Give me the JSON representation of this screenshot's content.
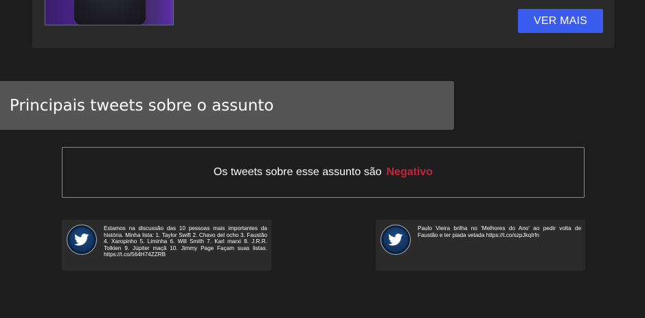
{
  "top_card": {
    "thumbnail_alt": "",
    "button_label": "VER MAIS"
  },
  "section": {
    "title": "Principais tweets sobre o assunto"
  },
  "sentiment": {
    "prefix": "Os tweets sobre esse assunto são",
    "value": "Negativo",
    "value_color": "#c0263f"
  },
  "tweets": [
    {
      "icon": "twitter-bird-icon",
      "text": "Estamos na discussão das 10 pessoas mais importantes da história. Minha lista: 1. Taylor Swift 2. Chavo del ocho 3. Faustão 4. Xaropinho 5. Liminha 6. Will Smith 7. Karl marxi 8. J.R.R. Tolkien 9. Júpiter maçã 10. Jimmy Page Façam suas listas. https://t.co/564H74ZZRB"
    },
    {
      "icon": "twitter-bird-icon",
      "text": "Paulo Vieira brilha no 'Melhores do Ano' ao pedir volta de Faustão e ter piada vetada https://t.co/szpJkqIrfn"
    }
  ],
  "colors": {
    "background": "#1e1e1e",
    "card": "#2a2a2a",
    "header": "#555555",
    "accent_button": "#3a5df0"
  }
}
